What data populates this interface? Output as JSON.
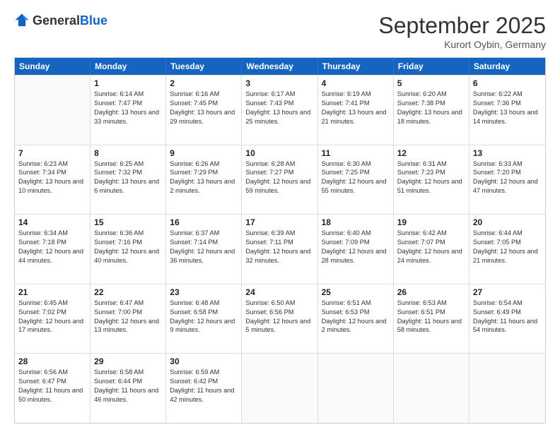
{
  "header": {
    "logo_general": "General",
    "logo_blue": "Blue",
    "month_title": "September 2025",
    "location": "Kurort Oybin, Germany"
  },
  "weekdays": [
    "Sunday",
    "Monday",
    "Tuesday",
    "Wednesday",
    "Thursday",
    "Friday",
    "Saturday"
  ],
  "rows": [
    [
      {
        "day": "",
        "sunrise": "",
        "sunset": "",
        "daylight": ""
      },
      {
        "day": "1",
        "sunrise": "Sunrise: 6:14 AM",
        "sunset": "Sunset: 7:47 PM",
        "daylight": "Daylight: 13 hours and 33 minutes."
      },
      {
        "day": "2",
        "sunrise": "Sunrise: 6:16 AM",
        "sunset": "Sunset: 7:45 PM",
        "daylight": "Daylight: 13 hours and 29 minutes."
      },
      {
        "day": "3",
        "sunrise": "Sunrise: 6:17 AM",
        "sunset": "Sunset: 7:43 PM",
        "daylight": "Daylight: 13 hours and 25 minutes."
      },
      {
        "day": "4",
        "sunrise": "Sunrise: 6:19 AM",
        "sunset": "Sunset: 7:41 PM",
        "daylight": "Daylight: 13 hours and 21 minutes."
      },
      {
        "day": "5",
        "sunrise": "Sunrise: 6:20 AM",
        "sunset": "Sunset: 7:38 PM",
        "daylight": "Daylight: 13 hours and 18 minutes."
      },
      {
        "day": "6",
        "sunrise": "Sunrise: 6:22 AM",
        "sunset": "Sunset: 7:36 PM",
        "daylight": "Daylight: 13 hours and 14 minutes."
      }
    ],
    [
      {
        "day": "7",
        "sunrise": "Sunrise: 6:23 AM",
        "sunset": "Sunset: 7:34 PM",
        "daylight": "Daylight: 13 hours and 10 minutes."
      },
      {
        "day": "8",
        "sunrise": "Sunrise: 6:25 AM",
        "sunset": "Sunset: 7:32 PM",
        "daylight": "Daylight: 13 hours and 6 minutes."
      },
      {
        "day": "9",
        "sunrise": "Sunrise: 6:26 AM",
        "sunset": "Sunset: 7:29 PM",
        "daylight": "Daylight: 13 hours and 2 minutes."
      },
      {
        "day": "10",
        "sunrise": "Sunrise: 6:28 AM",
        "sunset": "Sunset: 7:27 PM",
        "daylight": "Daylight: 12 hours and 59 minutes."
      },
      {
        "day": "11",
        "sunrise": "Sunrise: 6:30 AM",
        "sunset": "Sunset: 7:25 PM",
        "daylight": "Daylight: 12 hours and 55 minutes."
      },
      {
        "day": "12",
        "sunrise": "Sunrise: 6:31 AM",
        "sunset": "Sunset: 7:23 PM",
        "daylight": "Daylight: 12 hours and 51 minutes."
      },
      {
        "day": "13",
        "sunrise": "Sunrise: 6:33 AM",
        "sunset": "Sunset: 7:20 PM",
        "daylight": "Daylight: 12 hours and 47 minutes."
      }
    ],
    [
      {
        "day": "14",
        "sunrise": "Sunrise: 6:34 AM",
        "sunset": "Sunset: 7:18 PM",
        "daylight": "Daylight: 12 hours and 44 minutes."
      },
      {
        "day": "15",
        "sunrise": "Sunrise: 6:36 AM",
        "sunset": "Sunset: 7:16 PM",
        "daylight": "Daylight: 12 hours and 40 minutes."
      },
      {
        "day": "16",
        "sunrise": "Sunrise: 6:37 AM",
        "sunset": "Sunset: 7:14 PM",
        "daylight": "Daylight: 12 hours and 36 minutes."
      },
      {
        "day": "17",
        "sunrise": "Sunrise: 6:39 AM",
        "sunset": "Sunset: 7:11 PM",
        "daylight": "Daylight: 12 hours and 32 minutes."
      },
      {
        "day": "18",
        "sunrise": "Sunrise: 6:40 AM",
        "sunset": "Sunset: 7:09 PM",
        "daylight": "Daylight: 12 hours and 28 minutes."
      },
      {
        "day": "19",
        "sunrise": "Sunrise: 6:42 AM",
        "sunset": "Sunset: 7:07 PM",
        "daylight": "Daylight: 12 hours and 24 minutes."
      },
      {
        "day": "20",
        "sunrise": "Sunrise: 6:44 AM",
        "sunset": "Sunset: 7:05 PM",
        "daylight": "Daylight: 12 hours and 21 minutes."
      }
    ],
    [
      {
        "day": "21",
        "sunrise": "Sunrise: 6:45 AM",
        "sunset": "Sunset: 7:02 PM",
        "daylight": "Daylight: 12 hours and 17 minutes."
      },
      {
        "day": "22",
        "sunrise": "Sunrise: 6:47 AM",
        "sunset": "Sunset: 7:00 PM",
        "daylight": "Daylight: 12 hours and 13 minutes."
      },
      {
        "day": "23",
        "sunrise": "Sunrise: 6:48 AM",
        "sunset": "Sunset: 6:58 PM",
        "daylight": "Daylight: 12 hours and 9 minutes."
      },
      {
        "day": "24",
        "sunrise": "Sunrise: 6:50 AM",
        "sunset": "Sunset: 6:56 PM",
        "daylight": "Daylight: 12 hours and 5 minutes."
      },
      {
        "day": "25",
        "sunrise": "Sunrise: 6:51 AM",
        "sunset": "Sunset: 6:53 PM",
        "daylight": "Daylight: 12 hours and 2 minutes."
      },
      {
        "day": "26",
        "sunrise": "Sunrise: 6:53 AM",
        "sunset": "Sunset: 6:51 PM",
        "daylight": "Daylight: 11 hours and 58 minutes."
      },
      {
        "day": "27",
        "sunrise": "Sunrise: 6:54 AM",
        "sunset": "Sunset: 6:49 PM",
        "daylight": "Daylight: 11 hours and 54 minutes."
      }
    ],
    [
      {
        "day": "28",
        "sunrise": "Sunrise: 6:56 AM",
        "sunset": "Sunset: 6:47 PM",
        "daylight": "Daylight: 11 hours and 50 minutes."
      },
      {
        "day": "29",
        "sunrise": "Sunrise: 6:58 AM",
        "sunset": "Sunset: 6:44 PM",
        "daylight": "Daylight: 11 hours and 46 minutes."
      },
      {
        "day": "30",
        "sunrise": "Sunrise: 6:59 AM",
        "sunset": "Sunset: 6:42 PM",
        "daylight": "Daylight: 11 hours and 42 minutes."
      },
      {
        "day": "",
        "sunrise": "",
        "sunset": "",
        "daylight": ""
      },
      {
        "day": "",
        "sunrise": "",
        "sunset": "",
        "daylight": ""
      },
      {
        "day": "",
        "sunrise": "",
        "sunset": "",
        "daylight": ""
      },
      {
        "day": "",
        "sunrise": "",
        "sunset": "",
        "daylight": ""
      }
    ]
  ]
}
